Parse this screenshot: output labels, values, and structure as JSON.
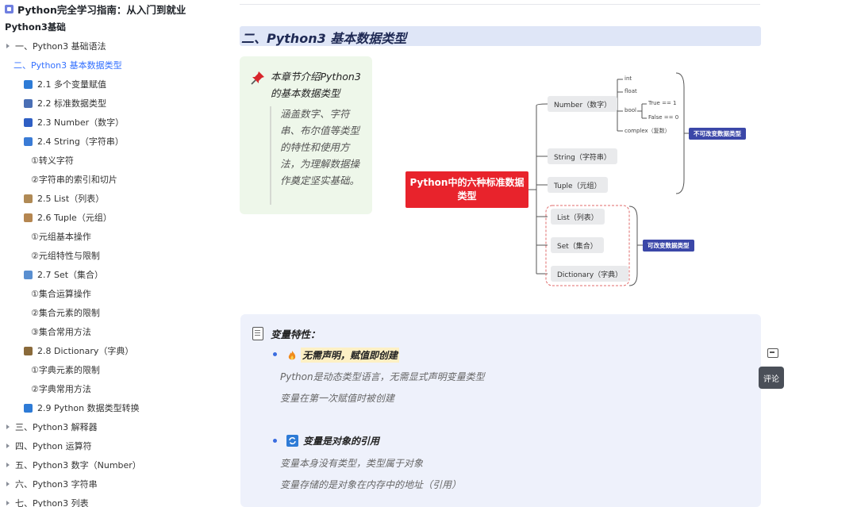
{
  "doc_title": "Python完全学习指南：从入门到就业",
  "section": "Python3基础",
  "nav": [
    {
      "label": "一、Python3 基础语法",
      "type": "chapter"
    },
    {
      "label": "二、Python3 基本数据类型",
      "type": "chapter-active"
    },
    {
      "label": "2.1 多个变量赋值",
      "type": "sub",
      "icon": "refresh-icon",
      "color": "#2e7bd6"
    },
    {
      "label": "2.2 标准数据类型",
      "type": "sub",
      "icon": "bar-chart-icon",
      "color": "#4a6fb5"
    },
    {
      "label": "2.3 Number（数字）",
      "type": "sub",
      "icon": "numbers-icon",
      "color": "#2f5fc4"
    },
    {
      "label": "2.4 String（字符串）",
      "type": "sub",
      "icon": "text-icon",
      "color": "#3a7bd5"
    },
    {
      "label": "①转义字符",
      "type": "subsub"
    },
    {
      "label": "②字符串的索引和切片",
      "type": "subsub"
    },
    {
      "label": "2.5 List（列表）",
      "type": "sub",
      "icon": "clipboard-icon",
      "color": "#b08a55"
    },
    {
      "label": "2.6 Tuple（元组）",
      "type": "sub",
      "icon": "package-icon",
      "color": "#b58650"
    },
    {
      "label": "①元组基本操作",
      "type": "subsub"
    },
    {
      "label": "②元组特性与限制",
      "type": "subsub"
    },
    {
      "label": "2.7 Set（集合）",
      "type": "sub",
      "icon": "magnifier-icon",
      "color": "#5a8fd0"
    },
    {
      "label": "①集合运算操作",
      "type": "subsub"
    },
    {
      "label": "②集合元素的限制",
      "type": "subsub"
    },
    {
      "label": "③集合常用方法",
      "type": "subsub"
    },
    {
      "label": "2.8 Dictionary（字典）",
      "type": "sub",
      "icon": "cabinet-icon",
      "color": "#8a6a3a"
    },
    {
      "label": "①字典元素的限制",
      "type": "subsub"
    },
    {
      "label": "②字典常用方法",
      "type": "subsub"
    },
    {
      "label": "2.9 Python 数据类型转换",
      "type": "sub2",
      "icon": "refresh-icon",
      "color": "#2e7bd6"
    },
    {
      "label": "三、Python3 解释器",
      "type": "chapter"
    },
    {
      "label": "四、Python 运算符",
      "type": "chapter"
    },
    {
      "label": "五、Python3 数字（Number）",
      "type": "chapter"
    },
    {
      "label": "六、Python3 字符串",
      "type": "chapter"
    },
    {
      "label": "七、Python3 列表",
      "type": "chapter"
    }
  ],
  "heading": "二、Python3 基本数据类型",
  "callout": {
    "title": "本章节介绍Python3的基本数据类型",
    "body": "涵盖数字、字符串、布尔值等类型的特性和使用方法，为理解数据操作奠定坚实基础。"
  },
  "mindmap": {
    "center": "Python中的六种标准数据类型",
    "nodes": [
      "Number（数字）",
      "String（字符串）",
      "Tuple（元组）",
      "List（列表）",
      "Set（集合）",
      "Dictionary（字典）"
    ],
    "number_leaves": [
      "int",
      "float",
      "bool",
      "complex（复数）"
    ],
    "bool_leaves": [
      "True == 1",
      "False == 0"
    ],
    "immutable_tag": "不可改变数据类型",
    "mutable_tag": "可改变数据类型"
  },
  "features": {
    "title": "变量特性：",
    "items": [
      {
        "title": "无需声明，赋值即创建",
        "icon": "fire-icon",
        "lines": [
          "Python是动态类型语言，无需显式声明变量类型",
          "变量在第一次赋值时被创建"
        ]
      },
      {
        "title": "变量是对象的引用",
        "icon": "refresh-icon",
        "lines": [
          "变量本身没有类型，类型属于对象",
          "变量存储的是对象在内存中的地址（引用）"
        ]
      }
    ]
  },
  "comment_label": "评论"
}
